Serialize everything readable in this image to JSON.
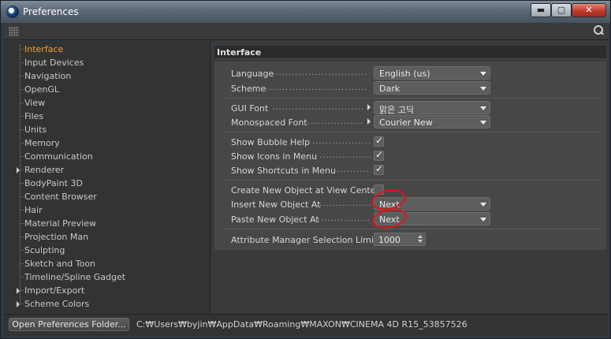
{
  "window": {
    "title": "Preferences",
    "min_label": "▬",
    "max_label": "▢",
    "close_label": "✕"
  },
  "sidebar": {
    "items": [
      {
        "label": "Interface",
        "selected": true,
        "expandable": false
      },
      {
        "label": "Input Devices",
        "selected": false,
        "expandable": false
      },
      {
        "label": "Navigation",
        "selected": false,
        "expandable": false
      },
      {
        "label": "OpenGL",
        "selected": false,
        "expandable": false
      },
      {
        "label": "View",
        "selected": false,
        "expandable": false
      },
      {
        "label": "Files",
        "selected": false,
        "expandable": false
      },
      {
        "label": "Units",
        "selected": false,
        "expandable": false
      },
      {
        "label": "Memory",
        "selected": false,
        "expandable": false
      },
      {
        "label": "Communication",
        "selected": false,
        "expandable": false
      },
      {
        "label": "Renderer",
        "selected": false,
        "expandable": true
      },
      {
        "label": "BodyPaint 3D",
        "selected": false,
        "expandable": false
      },
      {
        "label": "Content Browser",
        "selected": false,
        "expandable": false
      },
      {
        "label": "Hair",
        "selected": false,
        "expandable": false
      },
      {
        "label": "Material Preview",
        "selected": false,
        "expandable": false
      },
      {
        "label": "Projection Man",
        "selected": false,
        "expandable": false
      },
      {
        "label": "Sculpting",
        "selected": false,
        "expandable": false
      },
      {
        "label": "Sketch and Toon",
        "selected": false,
        "expandable": false
      },
      {
        "label": "Timeline/Spline Gadget",
        "selected": false,
        "expandable": false
      },
      {
        "label": "Import/Export",
        "selected": false,
        "expandable": true
      },
      {
        "label": "Scheme Colors",
        "selected": false,
        "expandable": true
      }
    ]
  },
  "panel": {
    "title": "Interface",
    "language": {
      "label": "Language",
      "value": "English (us)"
    },
    "scheme": {
      "label": "Scheme",
      "value": "Dark"
    },
    "gui_font": {
      "label": "GUI Font",
      "value": "맑은 고딕"
    },
    "mono_font": {
      "label": "Monospaced Font",
      "value": "Courier New"
    },
    "bubble_help": {
      "label": "Show Bubble Help",
      "checked": true
    },
    "icons_menu": {
      "label": "Show Icons in Menu",
      "checked": true
    },
    "shortcuts_menu": {
      "label": "Show Shortcuts in Menu",
      "checked": true
    },
    "create_new": {
      "label": "Create New Object at View Center",
      "checked": false
    },
    "insert_new": {
      "label": "Insert New Object At",
      "value": "Next"
    },
    "paste_new": {
      "label": "Paste New Object At",
      "value": "Next"
    },
    "attr_limit": {
      "label": "Attribute Manager Selection Limit",
      "value": "1000"
    }
  },
  "bottom": {
    "open_button": "Open Preferences Folder...",
    "path": "C:₩Users₩byjin₩AppData₩Roaming₩MAXON₩CINEMA 4D R15_53857526"
  },
  "check_glyph": "✓",
  "dots": "........................................",
  "colors": {
    "selected_item": "#f0a030",
    "annotation": "#e3131b"
  }
}
